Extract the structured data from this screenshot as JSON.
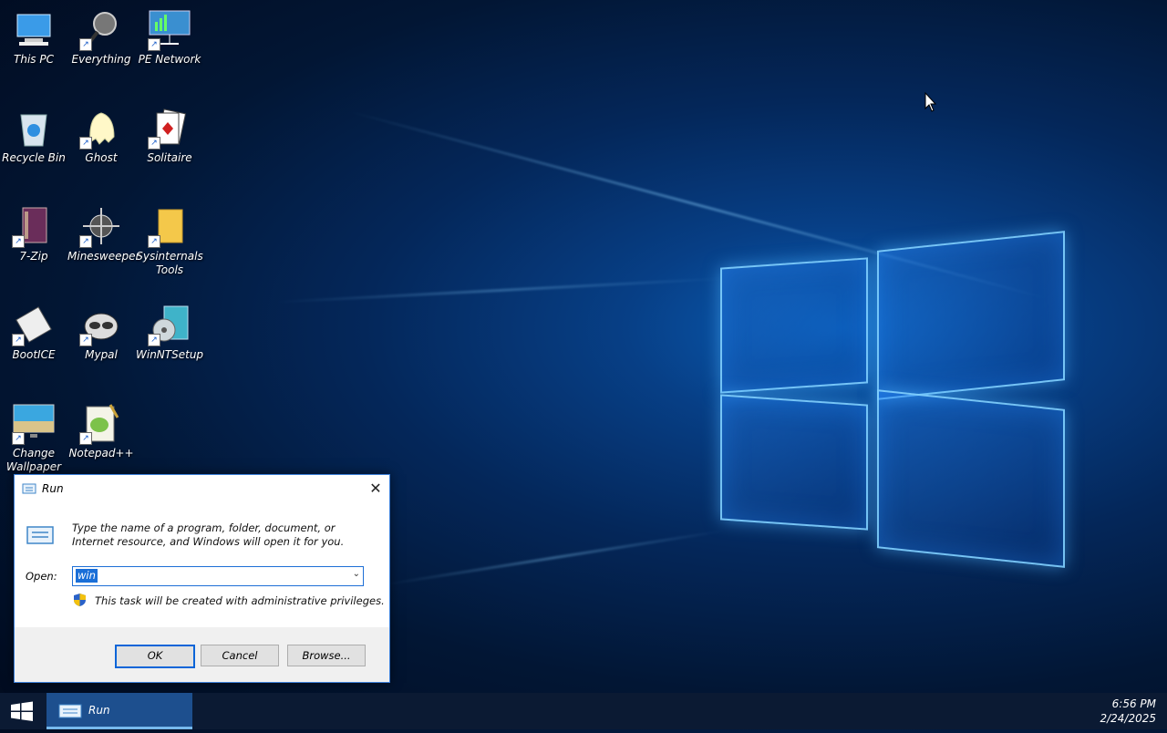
{
  "desktop": {
    "icons": [
      {
        "label": "This PC"
      },
      {
        "label": "Everything"
      },
      {
        "label": "PE Network"
      },
      {
        "label": "Recycle Bin"
      },
      {
        "label": "Ghost"
      },
      {
        "label": "Solitaire"
      },
      {
        "label": "7-Zip"
      },
      {
        "label": "Minesweeper"
      },
      {
        "label": "Sysinternals Tools"
      },
      {
        "label": "BootICE"
      },
      {
        "label": "Mypal"
      },
      {
        "label": "WinNTSetup"
      },
      {
        "label": "Change Wallpaper"
      },
      {
        "label": "Notepad++"
      }
    ]
  },
  "run_dialog": {
    "title": "Run",
    "description": "Type the name of a program, folder, document, or Internet resource, and Windows will open it for you.",
    "open_label": "Open:",
    "open_value": "win",
    "admin_note": "This task will be created with administrative privileges.",
    "ok_label": "OK",
    "cancel_label": "Cancel",
    "browse_label": "Browse..."
  },
  "taskbar": {
    "run_label": "Run",
    "time": "6:56 PM",
    "date": "2/24/2025"
  }
}
